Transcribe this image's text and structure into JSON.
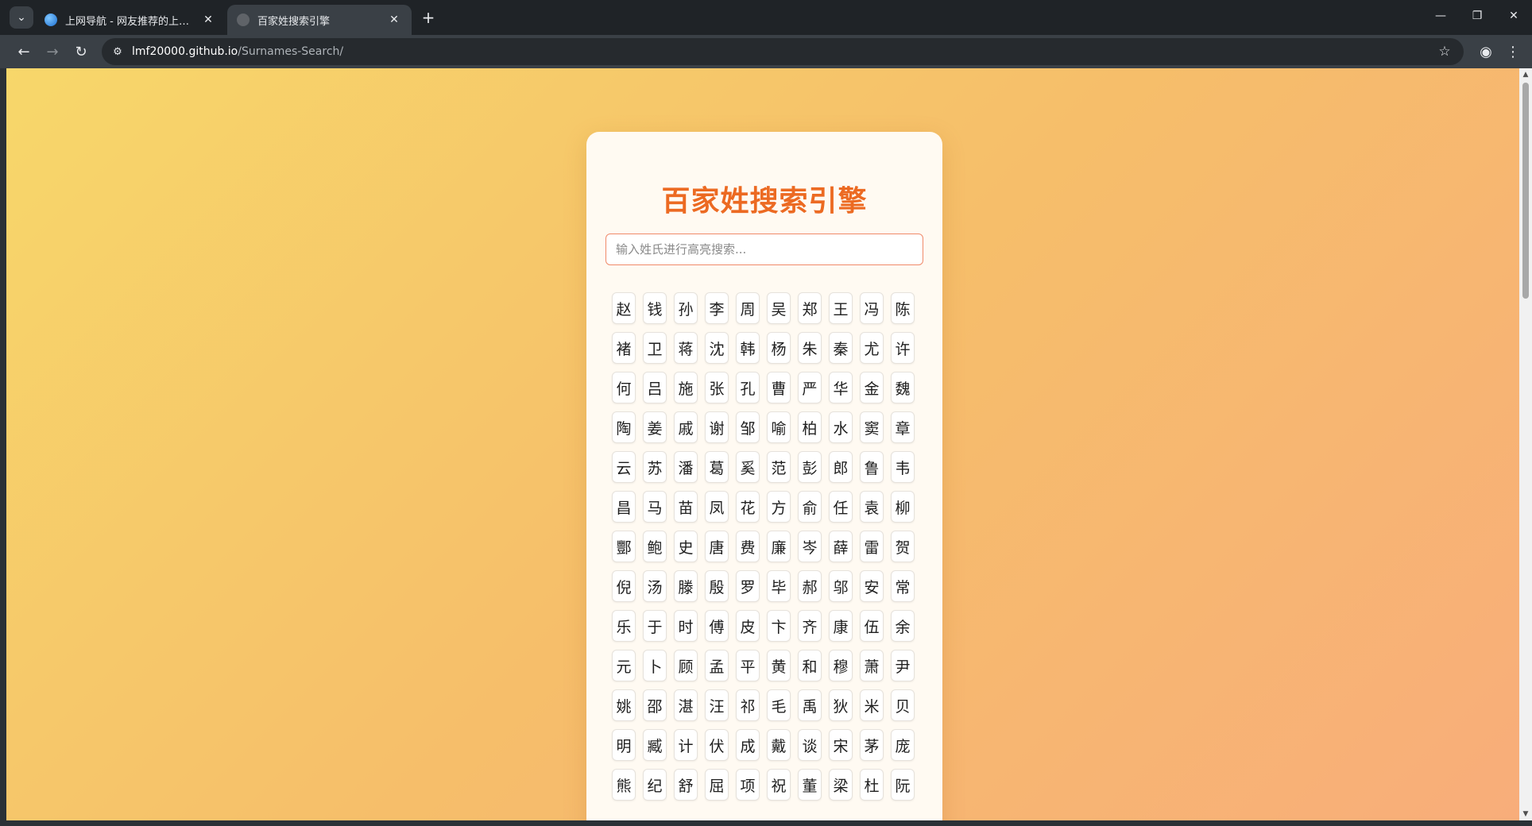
{
  "browser": {
    "tabs": [
      {
        "title": "上网导航 - 网友推荐的上网工具",
        "active": false
      },
      {
        "title": "百家姓搜索引擎",
        "active": true
      }
    ],
    "url": {
      "host": "lmf20000.github.io",
      "path": "/Surnames-Search/"
    },
    "icons": {
      "tab_search": "chevron-down-icon",
      "close": "close-icon",
      "new_tab": "plus-icon",
      "back": "arrow-left-icon",
      "forward": "arrow-right-icon",
      "reload": "reload-icon",
      "site_info": "tune-icon",
      "bookmark": "star-icon",
      "profile": "account-icon",
      "menu": "kebab-menu-icon",
      "minimize": "minimize-icon",
      "maximize": "restore-icon",
      "window_close": "close-icon"
    }
  },
  "page": {
    "title": "百家姓搜索引擎",
    "search": {
      "placeholder": "输入姓氏进行高亮搜索...",
      "value": ""
    },
    "surnames": [
      "赵",
      "钱",
      "孙",
      "李",
      "周",
      "吴",
      "郑",
      "王",
      "冯",
      "陈",
      "褚",
      "卫",
      "蒋",
      "沈",
      "韩",
      "杨",
      "朱",
      "秦",
      "尤",
      "许",
      "何",
      "吕",
      "施",
      "张",
      "孔",
      "曹",
      "严",
      "华",
      "金",
      "魏",
      "陶",
      "姜",
      "戚",
      "谢",
      "邹",
      "喻",
      "柏",
      "水",
      "窦",
      "章",
      "云",
      "苏",
      "潘",
      "葛",
      "奚",
      "范",
      "彭",
      "郎",
      "鲁",
      "韦",
      "昌",
      "马",
      "苗",
      "凤",
      "花",
      "方",
      "俞",
      "任",
      "袁",
      "柳",
      "酆",
      "鲍",
      "史",
      "唐",
      "费",
      "廉",
      "岑",
      "薛",
      "雷",
      "贺",
      "倪",
      "汤",
      "滕",
      "殷",
      "罗",
      "毕",
      "郝",
      "邬",
      "安",
      "常",
      "乐",
      "于",
      "时",
      "傅",
      "皮",
      "卞",
      "齐",
      "康",
      "伍",
      "余",
      "元",
      "卜",
      "顾",
      "孟",
      "平",
      "黄",
      "和",
      "穆",
      "萧",
      "尹",
      "姚",
      "邵",
      "湛",
      "汪",
      "祁",
      "毛",
      "禹",
      "狄",
      "米",
      "贝",
      "明",
      "臧",
      "计",
      "伏",
      "成",
      "戴",
      "谈",
      "宋",
      "茅",
      "庞",
      "熊",
      "纪",
      "舒",
      "屈",
      "项",
      "祝",
      "董",
      "梁",
      "杜",
      "阮"
    ]
  },
  "colors": {
    "title": "#ec6a22",
    "search_border": "#f08a6a",
    "background_start": "#f7d76a",
    "background_end": "#f8ad7a",
    "card": "#fffaf2"
  }
}
